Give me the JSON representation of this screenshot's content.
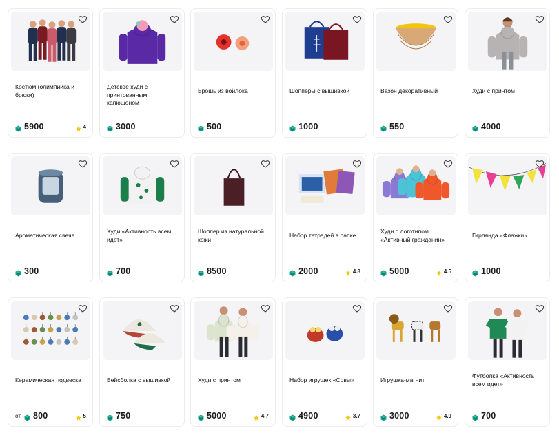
{
  "colors": {
    "coin": "#1aa08c",
    "star": "#f5c518",
    "heart": "#333333",
    "card_border": "#ececec",
    "image_bg": "#f4f4f6"
  },
  "products": [
    {
      "title": "Костюм (олимпийка и брюки)",
      "price": "5900",
      "from": "",
      "rating": "4",
      "image": "people-tracksuits"
    },
    {
      "title": "Детское худи с принтованным капюшоном",
      "price": "3000",
      "from": "",
      "rating": "",
      "image": "purple-hoodie"
    },
    {
      "title": "Брошь из войлока",
      "price": "500",
      "from": "",
      "rating": "",
      "image": "felt-flowers"
    },
    {
      "title": "Шопперы с вышивкой",
      "price": "1000",
      "from": "",
      "rating": "",
      "image": "tote-bags"
    },
    {
      "title": "Вазон декоративный",
      "price": "550",
      "from": "",
      "rating": "",
      "image": "bowl"
    },
    {
      "title": "Худи с принтом",
      "price": "4000",
      "from": "",
      "rating": "",
      "image": "woman-grey-hoodie"
    },
    {
      "title": "Ароматическая свеча",
      "price": "300",
      "from": "",
      "rating": "",
      "image": "candle"
    },
    {
      "title": "Худи «Активность всем идет»",
      "price": "700",
      "from": "",
      "rating": "",
      "image": "green-white-hoodie"
    },
    {
      "title": "Шоппер из натуральной кожи",
      "price": "8500",
      "from": "",
      "rating": "",
      "image": "leather-tote"
    },
    {
      "title": "Набор тетрадей в папке",
      "price": "2000",
      "from": "",
      "rating": "4.8",
      "image": "notebooks"
    },
    {
      "title": "Худи с логотипом «Активный гражданин»",
      "price": "5000",
      "from": "",
      "rating": "4.5",
      "image": "colored-hoodies"
    },
    {
      "title": "Гирлянда «Флажки»",
      "price": "1000",
      "from": "",
      "rating": "",
      "image": "bunting"
    },
    {
      "title": "Керамическая подвеска",
      "price": "800",
      "from": "от",
      "rating": "5",
      "image": "ceramic-pendants"
    },
    {
      "title": "Бейсболка с вышивкой",
      "price": "750",
      "from": "",
      "rating": "",
      "image": "caps"
    },
    {
      "title": "Худи с принтом",
      "price": "5000",
      "from": "",
      "rating": "4.7",
      "image": "couple-hoodies"
    },
    {
      "title": "Набор игрушек «Совы»",
      "price": "4900",
      "from": "",
      "rating": "3.7",
      "image": "owls"
    },
    {
      "title": "Игрушка-магнит",
      "price": "3000",
      "from": "",
      "rating": "4.9",
      "image": "animal-magnets"
    },
    {
      "title": "Футболка «Активность всем идет»",
      "price": "700",
      "from": "",
      "rating": "",
      "image": "couple-tshirts"
    }
  ]
}
